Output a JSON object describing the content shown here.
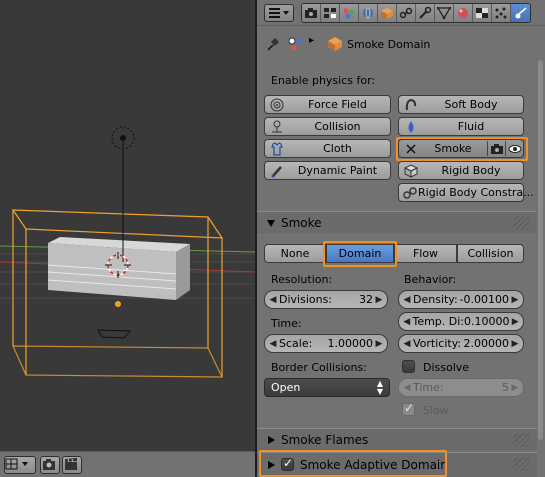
{
  "properties": {
    "breadcrumb": {
      "object_name": "Smoke Domain"
    },
    "physics": {
      "heading": "Enable physics for:",
      "force_field": "Force Field",
      "soft_body": "Soft Body",
      "collision": "Collision",
      "fluid": "Fluid",
      "cloth": "Cloth",
      "smoke": "Smoke",
      "dynamic_paint": "Dynamic Paint",
      "rigid_body": "Rigid Body",
      "rigid_body_constraint": "Rigid Body Constra..."
    },
    "smoke_panel": {
      "title": "Smoke",
      "types": [
        "None",
        "Domain",
        "Flow",
        "Collision"
      ],
      "selected_type": "Domain",
      "resolution_label": "Resolution:",
      "divisions_label": "Divisions:",
      "divisions_value": "32",
      "time_label": "Time:",
      "scale_label": "Scale:",
      "scale_value": "1.00000",
      "behavior_label": "Behavior:",
      "density_label": "Density:",
      "density_value": "-0.00100",
      "temp_label": "Temp. Di:",
      "temp_value": "0.10000",
      "vorticity_label": "Vorticity:",
      "vorticity_value": "2.00000",
      "border_label": "Border Collisions:",
      "border_value": "Open",
      "dissolve_label": "Dissolve",
      "dissolve_checked": false,
      "dissolve_time_label": "Time:",
      "dissolve_time_value": "5",
      "slow_label": "Slow",
      "slow_checked": true
    },
    "flames_panel": {
      "title": "Smoke Flames"
    },
    "adaptive_panel": {
      "title": "Smoke Adaptive Domain",
      "enabled": true
    }
  },
  "colors": {
    "highlight": "#f0902a",
    "selected": "#5680c2",
    "panel_bg": "#727272",
    "viewport_bg": "#393939",
    "domain_wire": "#f0a030"
  }
}
